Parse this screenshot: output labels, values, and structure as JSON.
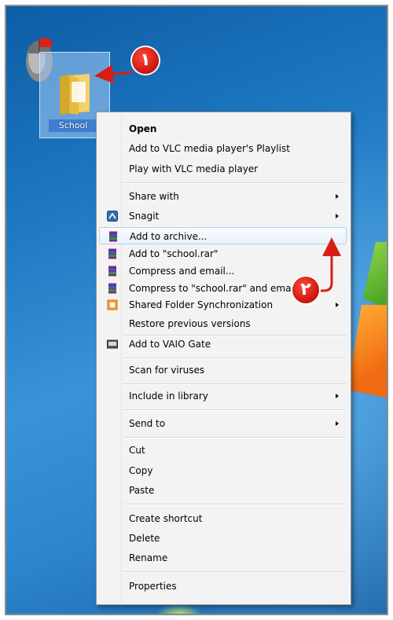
{
  "desktop": {
    "folder_label": "School",
    "colors": {
      "desktop_blue": "#1f78c2",
      "annotation_red": "#d81e14"
    }
  },
  "annotations": {
    "badge_1": "١",
    "badge_2": "٢"
  },
  "context_menu": {
    "items": [
      {
        "label": "Open",
        "bold": true
      },
      {
        "label": "Add to VLC media player's Playlist"
      },
      {
        "label": "Play with VLC media player"
      },
      {
        "label": "Share with",
        "submenu": true
      },
      {
        "label": "Snagit",
        "submenu": true,
        "icon": "snagit-icon"
      },
      {
        "label": "Add to archive...",
        "icon": "winrar-icon",
        "highlighted": true
      },
      {
        "label": "Add to \"school.rar\"",
        "icon": "winrar-icon"
      },
      {
        "label": "Compress and email...",
        "icon": "winrar-icon"
      },
      {
        "label": "Compress to \"school.rar\" and ema",
        "icon": "winrar-icon"
      },
      {
        "label": "Shared Folder Synchronization",
        "submenu": true,
        "icon": "sync-icon"
      },
      {
        "label": "Restore previous versions"
      },
      {
        "label": "Add to VAIO Gate",
        "icon": "vaio-gate-icon"
      },
      {
        "label": "Scan for viruses"
      },
      {
        "label": "Include in library",
        "submenu": true
      },
      {
        "label": "Send to",
        "submenu": true
      },
      {
        "label": "Cut"
      },
      {
        "label": "Copy"
      },
      {
        "label": "Paste"
      },
      {
        "label": "Create shortcut"
      },
      {
        "label": "Delete"
      },
      {
        "label": "Rename"
      },
      {
        "label": "Properties"
      }
    ]
  }
}
